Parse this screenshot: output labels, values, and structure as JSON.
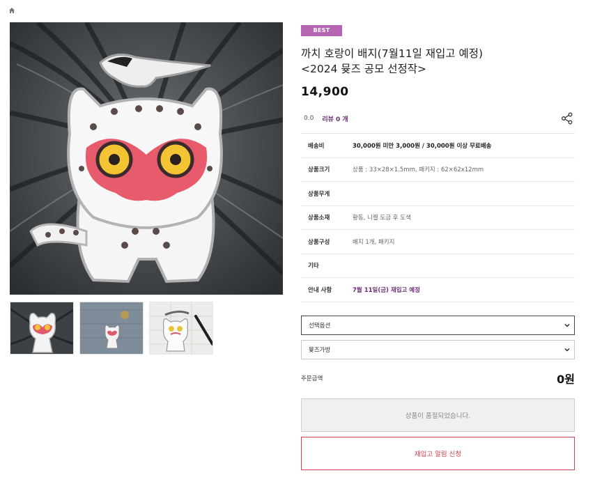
{
  "product": {
    "badge": "BEST",
    "title_line1": "까치 호랑이 배지(7월11일 재입고 예정)",
    "title_line2": "<2024 뮺즈 공모 선정작>",
    "price": "14,900",
    "rating": "0.0",
    "review_link": "리뷰 0 개"
  },
  "specs": [
    {
      "label": "배송비",
      "value": "30,000원 미만 3,000원 / 30,000원 이상 무료배송"
    },
    {
      "label": "상품크기",
      "value": "상품 : 33×28×1.5mm, 패키지 : 62×62x12mm"
    },
    {
      "label": "상품무게",
      "value": ""
    },
    {
      "label": "상품소재",
      "value": "황동, 니켈 도금 후 도색"
    },
    {
      "label": "상품구성",
      "value": "배지 1개, 패키지"
    },
    {
      "label": "기타",
      "value": ""
    },
    {
      "label": "안내 사항",
      "value": "7월 11일(금) 재입고 예정"
    }
  ],
  "options": {
    "select1": "선택옵션",
    "select2": "뮺즈가방"
  },
  "order": {
    "total_label": "주문금액",
    "total_value": "0원"
  },
  "buttons": {
    "soldout": "상품이 품절되었습니다.",
    "restock": "재입고 알림 신청"
  },
  "icons": {
    "home": "home-icon",
    "share": "share-icon",
    "dropdown": "chevron-down-icon"
  },
  "colors": {
    "badge": "#b565b1",
    "accent_purple": "#6b2c75",
    "restock_red": "#c9414a"
  }
}
